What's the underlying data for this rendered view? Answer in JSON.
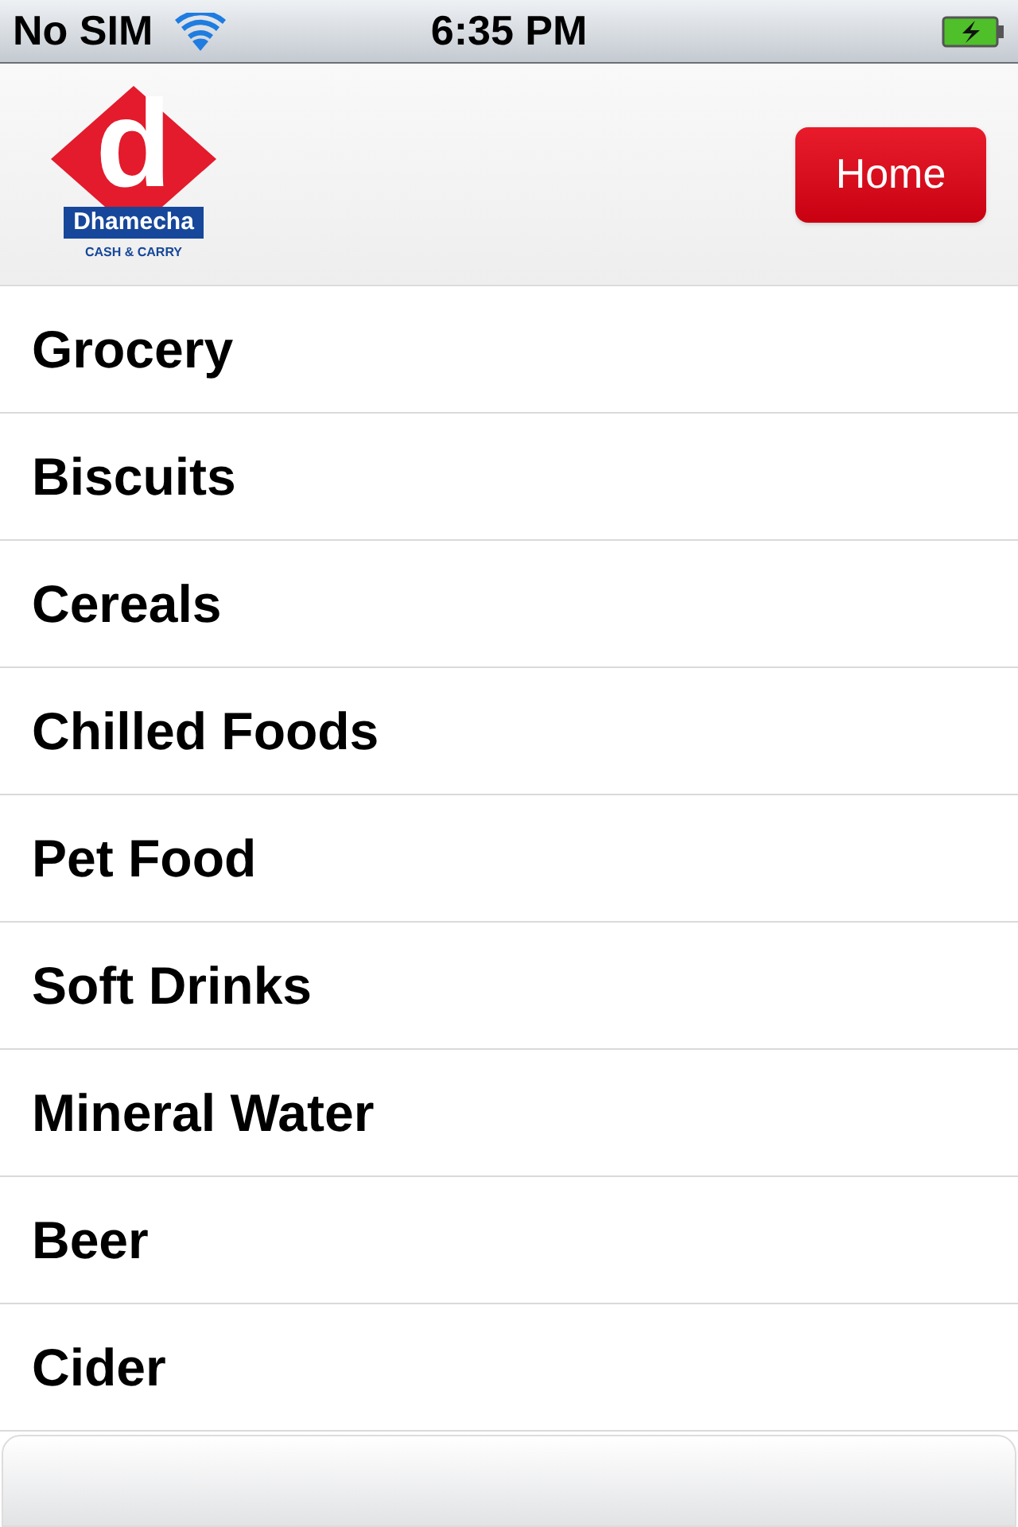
{
  "status_bar": {
    "carrier": "No SIM",
    "time": "6:35 PM"
  },
  "header": {
    "logo": {
      "letter": "d",
      "name": "Dhamecha",
      "tagline": "CASH & CARRY"
    },
    "home_button": "Home"
  },
  "categories": [
    "Grocery",
    "Biscuits",
    "Cereals",
    "Chilled Foods",
    "Pet Food",
    "Soft Drinks",
    "Mineral Water",
    "Beer",
    "Cider"
  ]
}
